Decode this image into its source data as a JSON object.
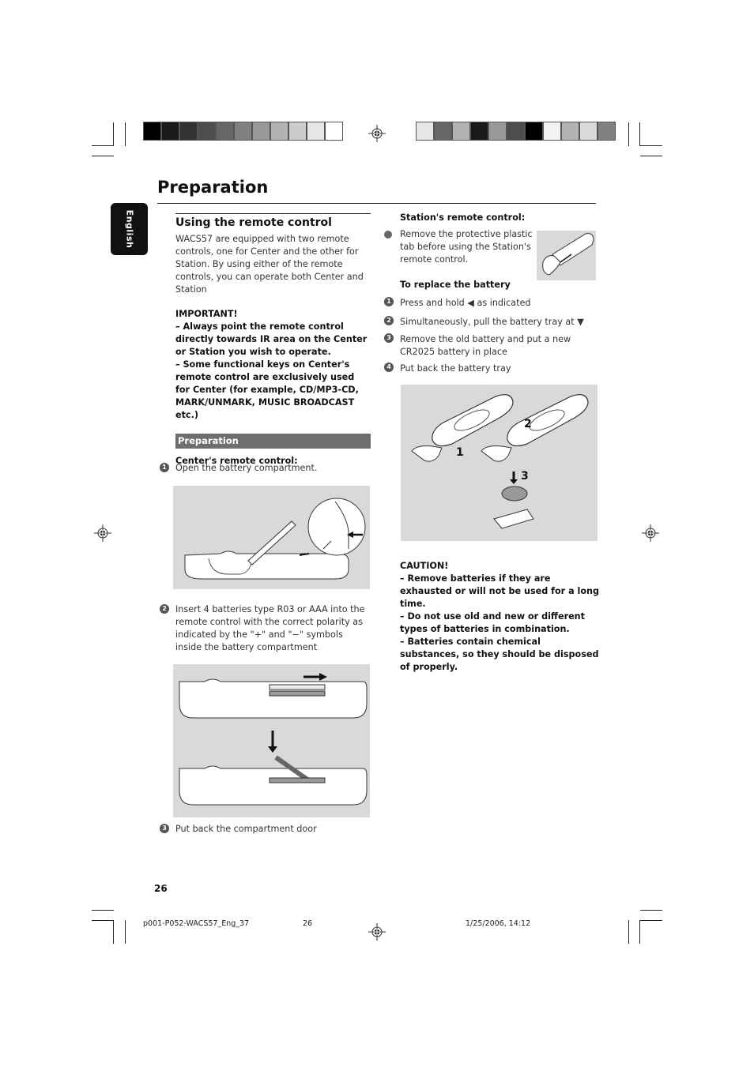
{
  "page": {
    "title": "Preparation",
    "language_tab": "English",
    "page_number": "26"
  },
  "color_bar_left": [
    "#000000",
    "#1a1a1a",
    "#333333",
    "#4d4d4d",
    "#666666",
    "#808080",
    "#999999",
    "#b3b3b3",
    "#cccccc",
    "#e6e6e6",
    "#ffffff"
  ],
  "color_bar_right": [
    "#e6e6e6",
    "#666666",
    "#b3b3b3",
    "#1a1a1a",
    "#999999",
    "#4d4d4d",
    "#000000",
    "#f2f2f2",
    "#b3b3b3",
    "#d9d9d9",
    "#808080"
  ],
  "left_column": {
    "section_heading": "Using the remote control",
    "intro": "WACS57 are equipped with two remote controls, one for Center and the other for Station. By using either of the remote controls, you can operate both Center and Station",
    "important": {
      "heading": "IMPORTANT!",
      "items": [
        "–   Always point the remote control directly towards IR area on the Center or Station you wish to operate.",
        "–   Some functional keys on Center's remote control are exclusively used for Center (for example, CD/MP3-CD, MARK/UNMARK, MUSIC BROADCAST etc.)"
      ]
    },
    "subsection_bar": "Preparation",
    "center_heading": "Center's remote control:",
    "steps": [
      {
        "num": "1",
        "text": "Open the battery compartment."
      },
      {
        "num": "2",
        "text": "Insert 4 batteries type R03 or AAA into the remote control with the correct polarity as indicated by the \"+\" and \"−\" symbols inside the battery compartment"
      },
      {
        "num": "3",
        "text": "Put back the compartment door"
      }
    ]
  },
  "right_column": {
    "station_heading": "Station's remote control:",
    "station_bullet": "Remove the protective plastic tab before using the Station's remote control.",
    "replace_heading": "To replace the battery",
    "steps": [
      {
        "num": "1",
        "text": "Press and hold ◀  as indicated"
      },
      {
        "num": "2",
        "text": "Simultaneously, pull the battery tray at  ▼"
      },
      {
        "num": "3",
        "text": "Remove the old battery and put a new CR2025 battery in place"
      },
      {
        "num": "4",
        "text": "Put back the battery tray"
      }
    ],
    "illustration_labels": [
      "1",
      "2",
      "3"
    ],
    "caution": {
      "heading": "CAUTION!",
      "items": [
        "–   Remove batteries if they are exhausted or will not be used for a long time.",
        "–   Do not use old and new or different types of batteries in combination.",
        "–   Batteries contain chemical substances, so they should be disposed of properly."
      ]
    }
  },
  "footer": {
    "file": "p001-P052-WACS57_Eng_37",
    "page": "26",
    "date": "1/25/2006, 14:12"
  }
}
